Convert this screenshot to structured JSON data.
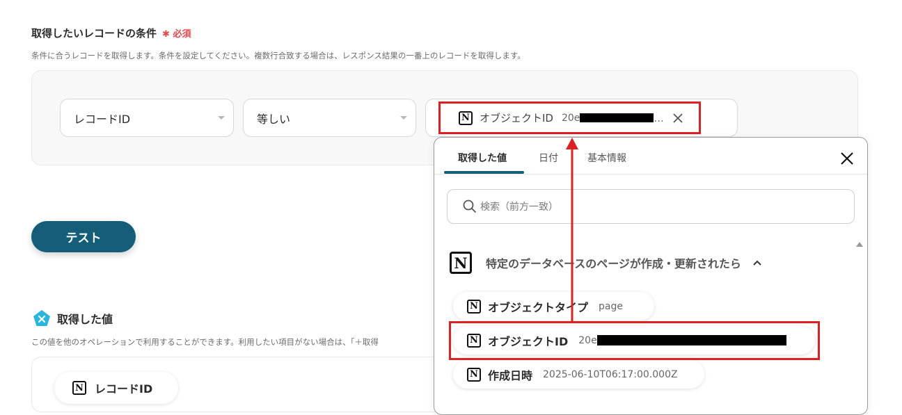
{
  "section": {
    "title": "取得したいレコードの条件",
    "required_label": "必須",
    "description": "条件に合うレコードを取得します。条件を設定してください。複数行合致する場合は、レスポンス結果の一番上のレコードを取得します。"
  },
  "condition": {
    "field": "レコードID",
    "operator": "等しい",
    "value_label": "オブジェクトID",
    "value_prefix": "20e",
    "value_suffix": "..."
  },
  "test_button": "テスト",
  "gained": {
    "title": "取得した値",
    "description": "この値を他のオペレーションで利用することができます。利用したい項目がない場合は、「＋取得",
    "first_item": "レコードID"
  },
  "popup": {
    "tabs": [
      "取得した値",
      "日付",
      "基本情報"
    ],
    "active_tab": 0,
    "search_placeholder": "検索（前方一致）",
    "group_title": "特定のデータベースのページが作成・更新されたら",
    "items": [
      {
        "label": "オブジェクトタイプ",
        "value": "page"
      },
      {
        "label": "オブジェクトID",
        "value": "20e"
      },
      {
        "label": "作成日時",
        "value": "2025-06-10T06:17:00.000Z"
      }
    ]
  },
  "colors": {
    "accent": "#155e7a",
    "required": "#e5484d",
    "highlight": "#e02020"
  }
}
